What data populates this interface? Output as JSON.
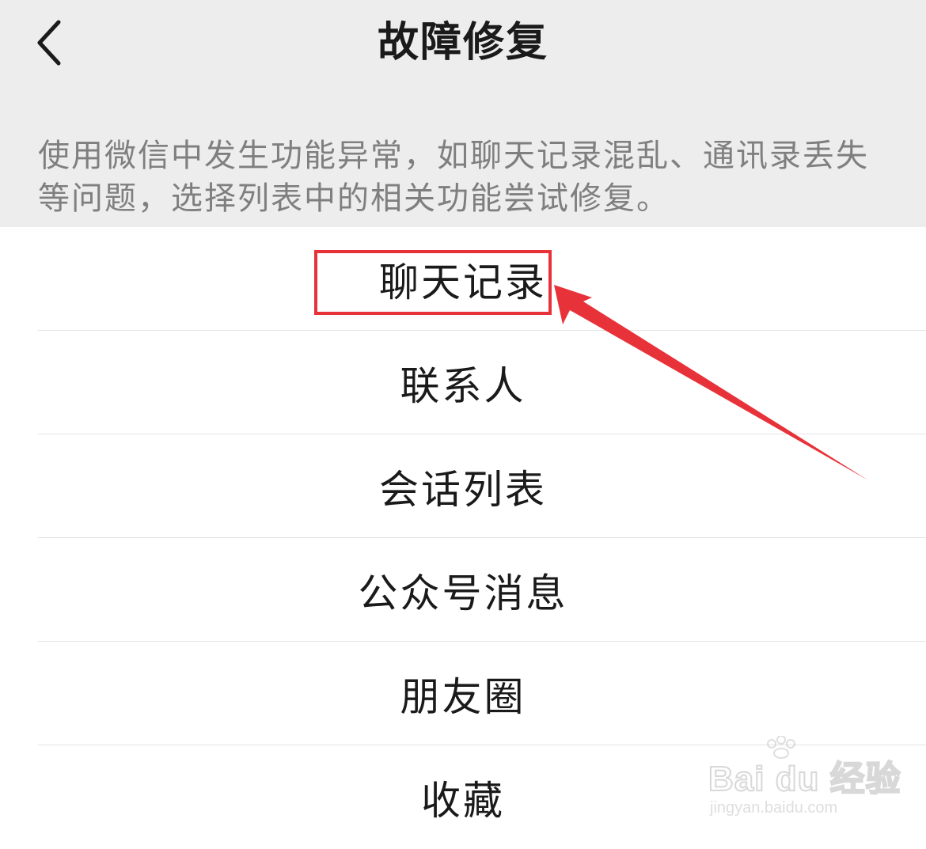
{
  "header": {
    "title": "故障修复",
    "description": "使用微信中发生功能异常，如聊天记录混乱、通讯录丢失等问题，选择列表中的相关功能尝试修复。"
  },
  "list": {
    "items": [
      {
        "label": "聊天记录"
      },
      {
        "label": "联系人"
      },
      {
        "label": "会话列表"
      },
      {
        "label": "公众号消息"
      },
      {
        "label": "朋友圈"
      },
      {
        "label": "收藏"
      }
    ]
  },
  "annotation": {
    "highlight_color": "#e8323a",
    "highlighted_item": "聊天记录"
  },
  "watermark": {
    "logo": "Bai du 经验",
    "url": "jingyan.baidu.com"
  },
  "icons": {
    "back": "chevron-left-icon"
  }
}
